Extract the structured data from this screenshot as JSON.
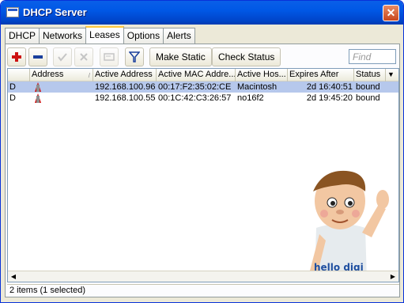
{
  "window": {
    "title": "DHCP Server",
    "close_glyph": "✕"
  },
  "tabs": [
    {
      "label": "DHCP"
    },
    {
      "label": "Networks"
    },
    {
      "label": "Leases"
    },
    {
      "label": "Options"
    },
    {
      "label": "Alerts"
    }
  ],
  "toolbar": {
    "icons": [
      "add-icon",
      "remove-icon",
      "enable-icon",
      "disable-icon",
      "comment-icon",
      "filter-icon"
    ],
    "make_static_label": "Make Static",
    "check_status_label": "Check Status",
    "find_placeholder": "Find"
  },
  "table": {
    "columns": [
      {
        "label": ""
      },
      {
        "label": "Address"
      },
      {
        "label": "Active Address"
      },
      {
        "label": "Active MAC Addre..."
      },
      {
        "label": "Active Hos..."
      },
      {
        "label": "Expires After"
      },
      {
        "label": "Status"
      }
    ],
    "rows": [
      {
        "flag": "D",
        "address": "",
        "active_address": "192.168.100.96",
        "mac": "00:17:F2:35:02:CE",
        "host": "Macintosh",
        "expires": "2d 16:40:51",
        "status": "bound",
        "selected": true
      },
      {
        "flag": "D",
        "address": "",
        "active_address": "192.168.100.55",
        "mac": "00:1C:42:C3:26:57",
        "host": "no16f2",
        "expires": "2d 19:45:20",
        "status": "bound",
        "selected": false
      }
    ]
  },
  "mascot": {
    "shirt_text": "hello digi"
  },
  "status_bar": {
    "text": "2 items (1 selected)"
  },
  "colors": {
    "title_blue": "#0058e6",
    "selection": "#b6c8ec",
    "accent_red": "#cc1111"
  }
}
